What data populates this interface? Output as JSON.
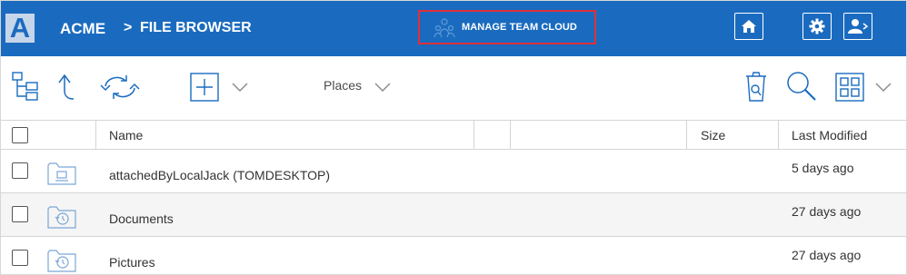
{
  "header": {
    "logo_letter": "A",
    "app_name": "ACME",
    "separator": ">",
    "page_title": "FILE BROWSER",
    "manage_label": "MANAGE TEAM CLOUD",
    "accent_color": "#1a6bbf",
    "highlight_color": "#e0303a",
    "buttons": [
      "home-icon",
      "gear-icon",
      "user-logout-icon"
    ]
  },
  "toolbar": {
    "places_label": "Places",
    "icons": [
      "folder-tree-icon",
      "up-arrow-icon",
      "refresh-icon",
      "add-icon",
      "chevron-down-icon",
      "recycle-bin-icon",
      "search-icon",
      "grid-view-icon",
      "chevron-down-icon"
    ]
  },
  "table": {
    "columns": [
      "Name",
      "Size",
      "Last Modified"
    ],
    "rows": [
      {
        "name": "attachedByLocalJack (TOMDESKTOP)",
        "size": "",
        "modified": "5 days ago",
        "icon": "network-folder-icon"
      },
      {
        "name": "Documents",
        "size": "",
        "modified": "27 days ago",
        "icon": "history-folder-icon"
      },
      {
        "name": "Pictures",
        "size": "",
        "modified": "27 days ago",
        "icon": "history-folder-icon"
      }
    ]
  }
}
